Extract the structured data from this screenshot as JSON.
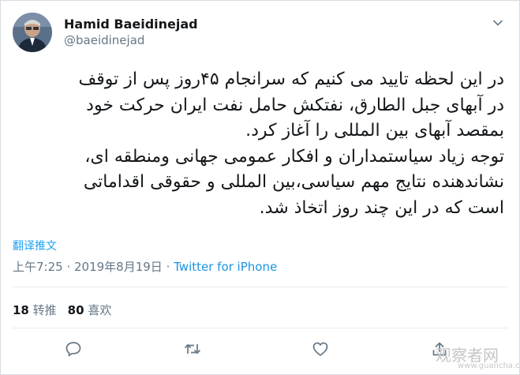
{
  "author": {
    "name": "Hamid Baeidinejad",
    "handle": "@baeidinejad"
  },
  "tweet": {
    "lines": [
      "در این لحظه تایید می کنیم که سرانجام ۴۵روز پس از توقف",
      "در آبهای جبل الطارق، نفتکش حامل نفت ایران حرکت خود",
      "بمقصد آبهای بین المللی را آغاز کرد.",
      "توجه زیاد سیاستمداران و افکار عمومی جهانی ومنطقه ای،",
      "نشاندهنده نتایج مهم سیاسی،بین المللی و حقوقی اقداماتی",
      "است که در این چند روز اتخاذ شد."
    ]
  },
  "translate_label": "翻译推文",
  "meta": {
    "time": "上午7:25",
    "separator": " · ",
    "date": "2019年8月19日",
    "separator2": " · ",
    "source": "Twitter for iPhone"
  },
  "stats": {
    "retweets_count": "18",
    "retweets_label": "转推",
    "likes_count": "80",
    "likes_label": "喜欢"
  },
  "icons": [
    "avatar",
    "chevron-down-icon",
    "reply-icon",
    "retweet-icon",
    "like-icon",
    "share-icon"
  ],
  "watermark": {
    "text": "观察者网",
    "url": "www.guancha.cn"
  },
  "colors": {
    "link": "#1da1f2",
    "secondary": "#657786",
    "text": "#14171a",
    "border": "#e6ecf0"
  }
}
